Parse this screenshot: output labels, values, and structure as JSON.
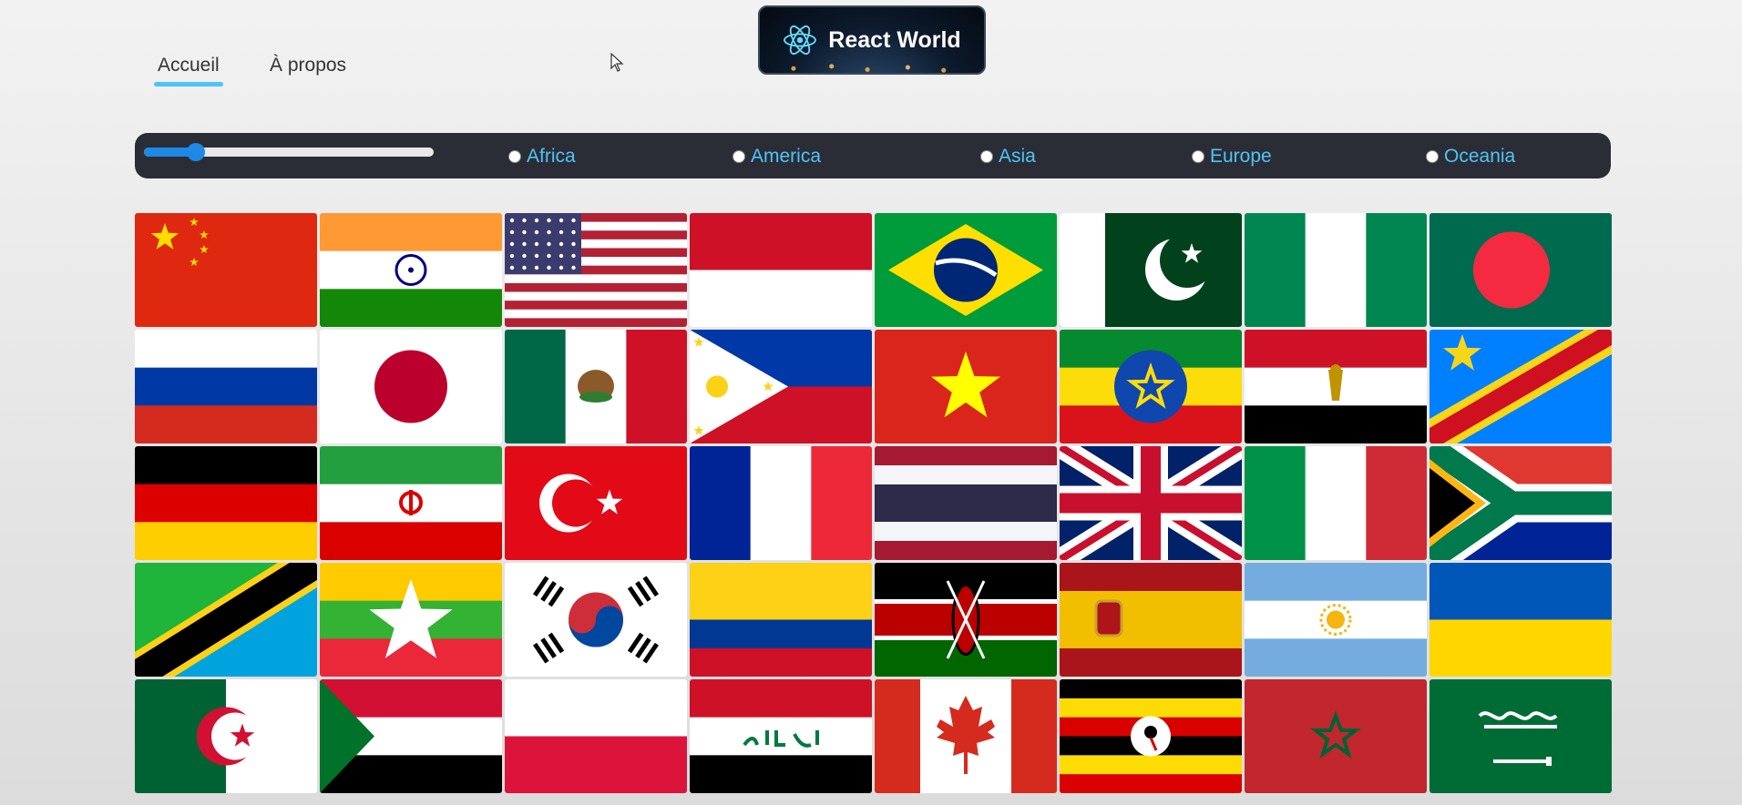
{
  "nav": {
    "links": [
      {
        "label": "Accueil",
        "active": true
      },
      {
        "label": "À propos",
        "active": false
      }
    ]
  },
  "logo": {
    "text": "React World",
    "icon": "react-atom-icon"
  },
  "filters": {
    "slider_value_fraction": 0.18,
    "regions": [
      "Africa",
      "America",
      "Asia",
      "Europe",
      "Oceania"
    ]
  },
  "flags": [
    "china",
    "india",
    "united-states",
    "indonesia",
    "brazil",
    "pakistan",
    "nigeria",
    "bangladesh",
    "russia",
    "japan",
    "mexico",
    "philippines",
    "vietnam",
    "ethiopia",
    "egypt",
    "dr-congo",
    "germany",
    "iran",
    "turkey",
    "france",
    "thailand",
    "united-kingdom",
    "italy",
    "south-africa",
    "tanzania",
    "myanmar",
    "south-korea",
    "colombia",
    "kenya",
    "spain",
    "argentina",
    "ukraine",
    "algeria",
    "sudan",
    "poland",
    "iraq",
    "canada",
    "uganda",
    "morocco",
    "saudi-arabia"
  ],
  "colors": {
    "accent": "#4fc3f7",
    "bar": "#2a2d35",
    "slider": "#1e88e5"
  }
}
